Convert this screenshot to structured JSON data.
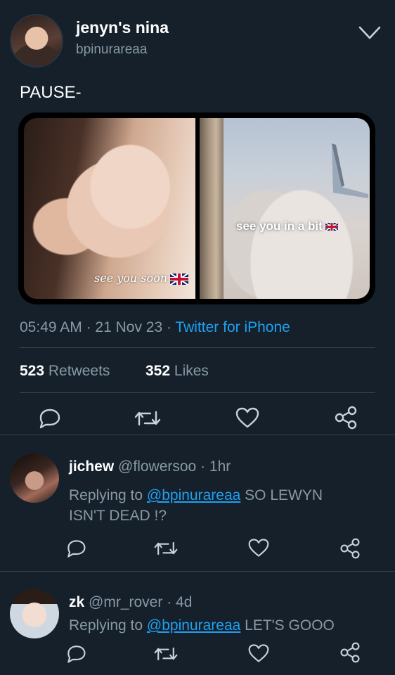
{
  "tweet": {
    "display_name": "jenyn's nina",
    "username": "bpinurareaa",
    "text": "PAUSE-",
    "media": {
      "left_caption": "see you soon",
      "right_caption": "see you in a bit"
    },
    "meta": {
      "time": "05:49 AM",
      "date": "21 Nov 23",
      "source": "Twitter for iPhone"
    },
    "stats": {
      "retweets_count": "523",
      "retweets_label": "Retweets",
      "likes_count": "352",
      "likes_label": "Likes"
    },
    "menu_icon": "chevron-down-icon"
  },
  "replies": [
    {
      "display_name": "jichew",
      "username": "@flowersoo",
      "time": "1hr",
      "replying_prefix": "Replying to",
      "replying_handle": "@bpinurareaa",
      "text_line1": "SO LEWYN",
      "text_line2": "ISN'T DEAD !?"
    },
    {
      "display_name": "zk",
      "username": "@mr_rover",
      "time": "4d",
      "replying_prefix": "Replying to",
      "replying_handle": "@bpinurareaa",
      "text_line1": "LET'S GOOO"
    }
  ],
  "icons": {
    "reply": "reply-icon",
    "retweet": "retweet-icon",
    "like": "heart-icon",
    "share": "share-icon"
  },
  "colors": {
    "background": "#15202b",
    "link": "#1da1f2",
    "muted": "#8899a6",
    "divider": "#38444d"
  }
}
